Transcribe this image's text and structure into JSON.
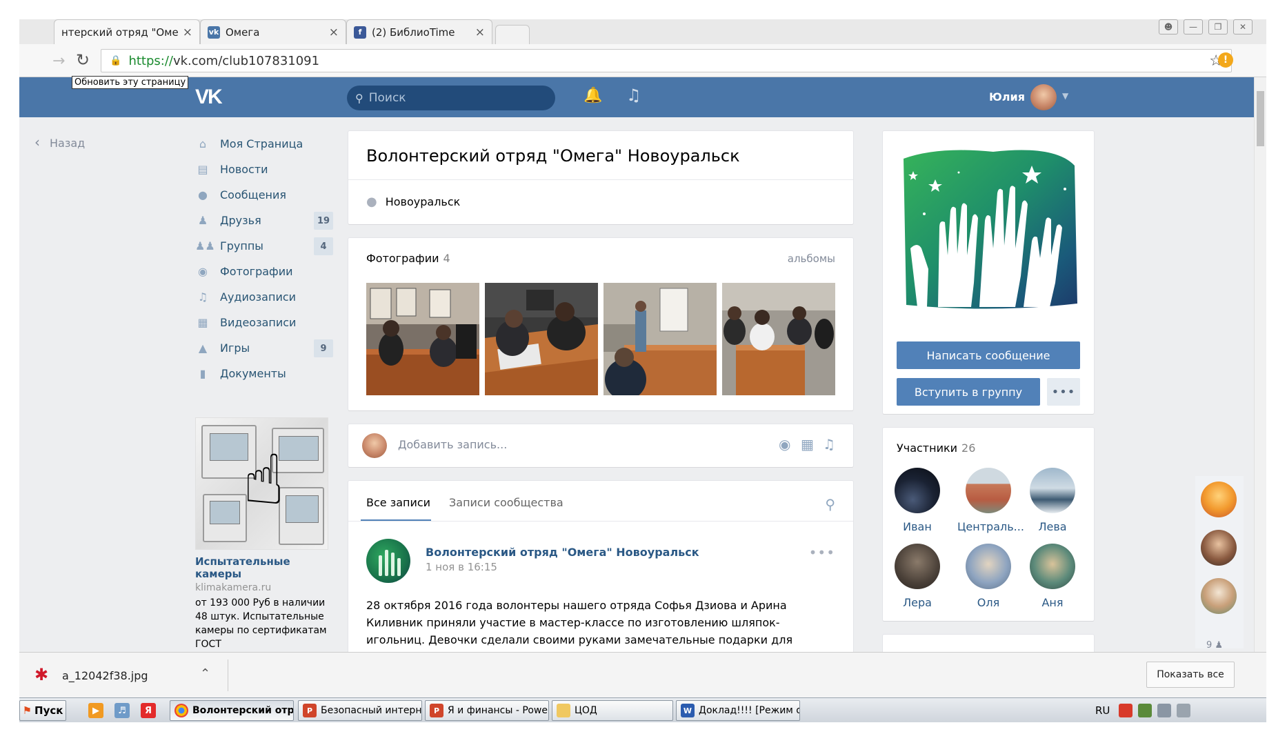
{
  "browser": {
    "tabs": [
      {
        "title": "нтерский отряд \"Оме",
        "favicon": "vk-icon"
      },
      {
        "title": "Омега",
        "favicon": "vk-icon"
      },
      {
        "title": "(2) БиблиоTime",
        "favicon": "facebook-icon"
      }
    ],
    "url_prefix": "https://",
    "url_rest": "vk.com/club107831091",
    "reload_tooltip": "Обновить эту страницу"
  },
  "header": {
    "logo": "VK",
    "search_placeholder": "Поиск",
    "user_name": "Юлия"
  },
  "nav": {
    "back": "Назад",
    "items": [
      {
        "label": "Моя Страница",
        "icon": "home-icon",
        "count": ""
      },
      {
        "label": "Новости",
        "icon": "news-icon",
        "count": ""
      },
      {
        "label": "Сообщения",
        "icon": "messages-icon",
        "count": ""
      },
      {
        "label": "Друзья",
        "icon": "friends-icon",
        "count": "19"
      },
      {
        "label": "Группы",
        "icon": "groups-icon",
        "count": "4"
      },
      {
        "label": "Фотографии",
        "icon": "camera-icon",
        "count": ""
      },
      {
        "label": "Аудиозаписи",
        "icon": "music-icon",
        "count": ""
      },
      {
        "label": "Видеозаписи",
        "icon": "video-icon",
        "count": ""
      },
      {
        "label": "Игры",
        "icon": "gamepad-icon",
        "count": "9"
      },
      {
        "label": "Документы",
        "icon": "document-icon",
        "count": ""
      }
    ]
  },
  "ad": {
    "title": "Испытательные камеры",
    "domain": "klimakamera.ru",
    "text": "от 193 000 Руб в наличии 48 штук. Испытательные камеры по сертификатам ГОСТ"
  },
  "group": {
    "title": "Волонтерский отряд \"Омега\" Новоуральск",
    "location": "Новоуральск"
  },
  "photos": {
    "label": "Фотографии",
    "count": "4",
    "albums_link": "альбомы"
  },
  "composer": {
    "placeholder": "Добавить запись..."
  },
  "feed": {
    "tab_all": "Все записи",
    "tab_community": "Записи сообщества",
    "post": {
      "author": "Волонтерский отряд \"Омега\" Новоуральск",
      "date": "1 ноя в 16:15",
      "text": "28 октября 2016 года волонтеры нашего отряда Софья Дзиова и Арина Киливник приняли участие в мастер-классе по изготовлению шляпок-игольниц. Девочки сделали своими руками замечательные подарки для многодетных мам к Дню"
    }
  },
  "actions": {
    "write_message": "Написать сообщение",
    "join_group": "Вступить в группу",
    "more": "•••"
  },
  "members": {
    "label": "Участники",
    "count": "26",
    "list": [
      {
        "name": "Иван"
      },
      {
        "name": "Централь..."
      },
      {
        "name": "Лева"
      },
      {
        "name": "Лера"
      },
      {
        "name": "Оля"
      },
      {
        "name": "Аня"
      }
    ]
  },
  "chat": {
    "online_count": "9"
  },
  "download": {
    "file": "a_12042f38.jpg",
    "show_all": "Показать все"
  },
  "taskbar": {
    "start": "Пуск",
    "tasks": [
      {
        "label": "Волонтерский отряд...",
        "active": true
      },
      {
        "label": "Безопасный интернет -...",
        "active": false
      },
      {
        "label": "Я и финансы - PowerPoint",
        "active": false
      },
      {
        "label": "ЦОД",
        "active": false
      },
      {
        "label": "Доклад!!!! [Режим огра...",
        "active": false
      }
    ],
    "lang": "RU"
  },
  "colors": {
    "vk_blue": "#4a76a8",
    "button_blue": "#5181b8",
    "link": "#2a5885",
    "page_bg": "#edeef0"
  }
}
